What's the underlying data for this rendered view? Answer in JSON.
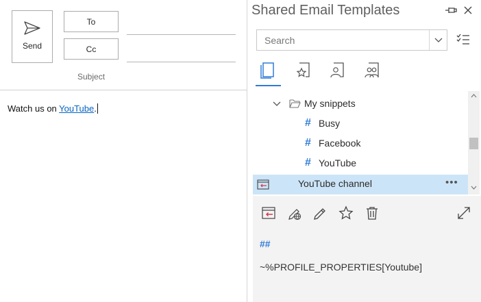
{
  "compose": {
    "send_label": "Send",
    "to_label": "To",
    "cc_label": "Cc",
    "subject_label": "Subject",
    "body_prefix": "Watch us on ",
    "body_link": "YouTube",
    "body_suffix": "."
  },
  "pane": {
    "title": "Shared Email Templates",
    "search_placeholder": "Search",
    "tabs": [
      {
        "name": "my-templates",
        "icon": "document-icon",
        "selected": true
      },
      {
        "name": "favorites",
        "icon": "star-document-icon",
        "selected": false
      },
      {
        "name": "team-templates",
        "icon": "user-document-icon",
        "selected": false
      },
      {
        "name": "shared-templates",
        "icon": "users-document-icon",
        "selected": false
      }
    ],
    "tree": {
      "folder": "My snippets",
      "items": [
        {
          "hash": "#",
          "label": "Busy"
        },
        {
          "hash": "#",
          "label": "Facebook"
        },
        {
          "hash": "#",
          "label": "YouTube"
        }
      ],
      "selected_template": "YouTube channel",
      "more": "•••"
    },
    "preview": {
      "hash": "##",
      "macro": "~%PROFILE_PROPERTIES[Youtube]"
    }
  },
  "colors": {
    "accent": "#2f7bd6",
    "selection": "#cce4f7",
    "link": "#0563c1",
    "insert_red": "#d9364a"
  }
}
